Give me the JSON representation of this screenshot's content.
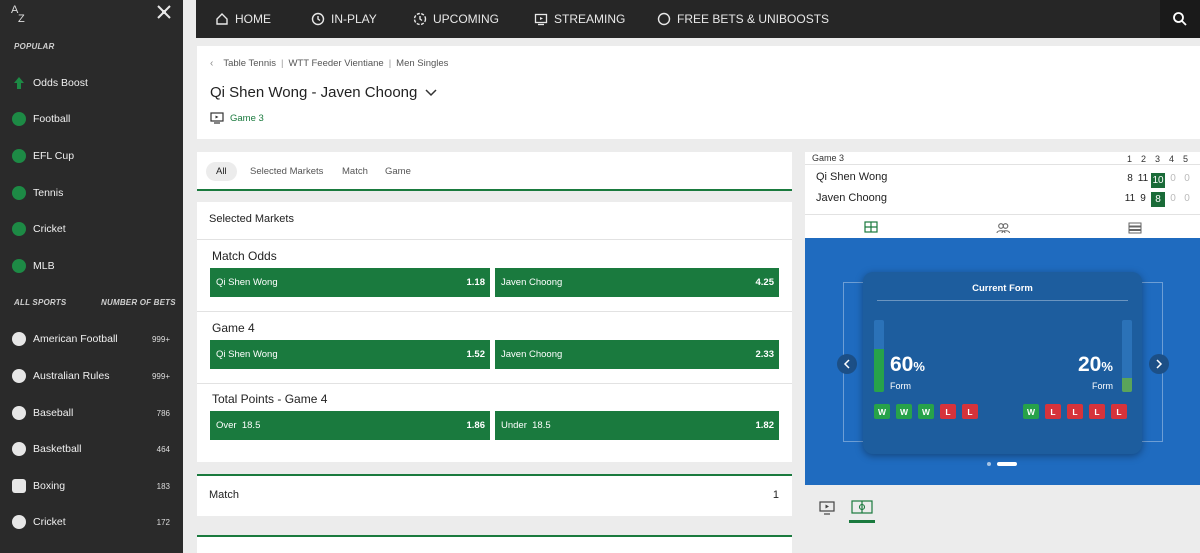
{
  "sidebar": {
    "popular_label": "POPULAR",
    "popular": [
      {
        "label": "Odds Boost",
        "icon": "odds-boost-icon"
      },
      {
        "label": "Football",
        "icon": "football-icon"
      },
      {
        "label": "EFL Cup",
        "icon": "efl-cup-icon"
      },
      {
        "label": "Tennis",
        "icon": "tennis-icon"
      },
      {
        "label": "Cricket",
        "icon": "cricket-icon"
      },
      {
        "label": "MLB",
        "icon": "mlb-icon"
      }
    ],
    "all_sports_label": "ALL SPORTS",
    "number_of_bets_label": "NUMBER OF BETS",
    "sports": [
      {
        "label": "American Football",
        "count": "999+",
        "icon": "american-football-icon"
      },
      {
        "label": "Australian Rules",
        "count": "999+",
        "icon": "australian-rules-icon"
      },
      {
        "label": "Baseball",
        "count": "786",
        "icon": "baseball-icon"
      },
      {
        "label": "Basketball",
        "count": "464",
        "icon": "basketball-icon"
      },
      {
        "label": "Boxing",
        "count": "183",
        "icon": "boxing-icon"
      },
      {
        "label": "Cricket",
        "count": "172",
        "icon": "cricket-icon"
      }
    ]
  },
  "nav": {
    "items": [
      {
        "label": "HOME",
        "icon": "home-icon"
      },
      {
        "label": "IN-PLAY",
        "icon": "clock-icon"
      },
      {
        "label": "UPCOMING",
        "icon": "upcoming-icon"
      },
      {
        "label": "STREAMING",
        "icon": "streaming-icon"
      },
      {
        "label": "FREE BETS & UNIBOOSTS",
        "icon": "free-bets-icon"
      }
    ]
  },
  "event": {
    "breadcrumb": [
      "Table Tennis",
      "WTT Feeder Vientiane",
      "Men Singles"
    ],
    "title": "Qi Shen Wong - Javen Choong",
    "game_link": "Game 3"
  },
  "filters": [
    "All",
    "Selected Markets",
    "Match",
    "Game"
  ],
  "markets": {
    "section_title": "Selected Markets",
    "groups": [
      {
        "name": "Match Odds",
        "outcomes": [
          {
            "label": "Qi Shen Wong",
            "price": "1.18"
          },
          {
            "label": "Javen Choong",
            "price": "4.25"
          }
        ]
      },
      {
        "name": "Game 4",
        "outcomes": [
          {
            "label": "Qi Shen Wong",
            "price": "1.52"
          },
          {
            "label": "Javen Choong",
            "price": "2.33"
          }
        ]
      },
      {
        "name": "Total Points - Game 4",
        "outcomes": [
          {
            "label": "Over  18.5",
            "price": "1.86"
          },
          {
            "label": "Under  18.5",
            "price": "1.82"
          }
        ]
      }
    ],
    "match_row": {
      "label": "Match",
      "count": "1"
    }
  },
  "scoreboard": {
    "game_label": "Game 3",
    "columns": [
      "1",
      "2",
      "3",
      "4",
      "5"
    ],
    "players": [
      {
        "name": "Qi Shen Wong",
        "scores": [
          "8",
          "11",
          "10",
          "0",
          "0"
        ]
      },
      {
        "name": "Javen Choong",
        "scores": [
          "11",
          "9",
          "8",
          "0",
          "0"
        ]
      }
    ],
    "current_game_index": 2
  },
  "form": {
    "title": "Current Form",
    "left": {
      "pct": "60",
      "label": "Form",
      "fill": 0.6,
      "results": [
        "W",
        "W",
        "W",
        "L",
        "L"
      ]
    },
    "right": {
      "pct": "20",
      "label": "Form",
      "fill": 0.2,
      "results": [
        "W",
        "L",
        "L",
        "L",
        "L"
      ]
    },
    "pct_sign": "%"
  },
  "colors": {
    "brand_green": "#1a7a3e",
    "nav_dark": "#262626",
    "viz_blue": "#1f6bbf",
    "win": "#27a24a",
    "loss": "#d6333b"
  }
}
